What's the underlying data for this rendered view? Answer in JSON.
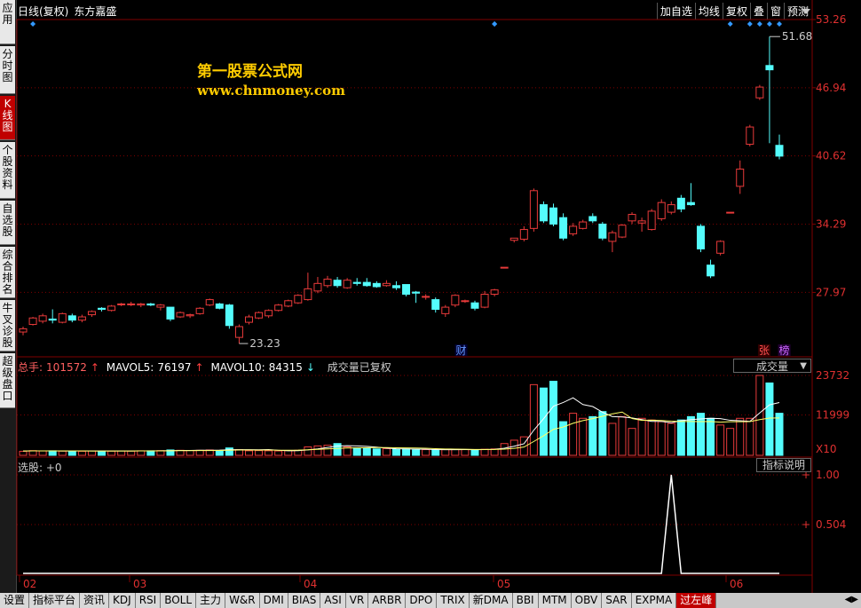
{
  "colors": {
    "up": "#e83a3a",
    "down": "#54fcfc",
    "grid": "#800000",
    "accent": "#ffcc00",
    "ma5": "#ffffff",
    "ma10": "#ffff66"
  },
  "sidebar": {
    "items": [
      {
        "label": "应用",
        "active": false
      },
      {
        "label": "分时图",
        "active": false
      },
      {
        "label": "K线图",
        "active": true
      },
      {
        "label": "个股资料",
        "active": false
      },
      {
        "label": "自选股",
        "active": false
      },
      {
        "label": "综合排名",
        "active": false
      },
      {
        "label": "牛叉诊股",
        "active": false
      },
      {
        "label": "超级盘口",
        "active": false
      }
    ]
  },
  "header": {
    "title": "日线(复权)",
    "stock_name": "东方嘉盛"
  },
  "toolbar": {
    "buttons": [
      "加自选",
      "均线",
      "复权",
      "叠",
      "窗",
      "预测"
    ],
    "dropdown_icon": "triangle-down-icon"
  },
  "watermark": {
    "line1": "第一股票公式网",
    "line2": "www.chnmoney.com"
  },
  "price_axis": {
    "ticks": [
      "53.26",
      "46.94",
      "40.62",
      "34.29",
      "27.97"
    ],
    "max_label": "51.68",
    "min_label": "23.23"
  },
  "markers": {
    "cai": "财",
    "zhang": "张",
    "bang": "榜"
  },
  "volume": {
    "total_label": "总手:",
    "total": "101572",
    "ma5_label": "MAVOL5:",
    "ma5": "76197",
    "ma10_label": "MAVOL10:",
    "ma10": "84315",
    "note": "成交量已复权",
    "selector": "成交量",
    "ticks": [
      "23732",
      "11999"
    ],
    "unit": "X10"
  },
  "selection": {
    "label": "选股: +0",
    "button": "指标说明",
    "ticks": [
      "1.00",
      "0.504"
    ]
  },
  "months": [
    "02",
    "03",
    "04",
    "05",
    "06"
  ],
  "bottom_tabs": [
    "设置",
    "指标平台",
    "资讯",
    "KDJ",
    "RSI",
    "BOLL",
    "主力",
    "W&R",
    "DMI",
    "BIAS",
    "ASI",
    "VR",
    "ARBR",
    "DPO",
    "TRIX",
    "新DMA",
    "BBI",
    "MTM",
    "OBV",
    "SAR",
    "EXPMA",
    "过左峰"
  ],
  "chart_data": {
    "type": "candlestick",
    "ylim": [
      22,
      53.26
    ],
    "candles": [
      [
        24.3,
        24.6,
        24.0,
        24.8
      ],
      [
        25.0,
        25.6,
        24.9,
        25.7
      ],
      [
        25.3,
        25.8,
        25.1,
        26.0
      ],
      [
        25.5,
        25.4,
        25.1,
        26.4
      ],
      [
        25.2,
        26.0,
        25.1,
        26.1
      ],
      [
        25.8,
        25.4,
        25.2,
        26.0
      ],
      [
        25.4,
        25.7,
        25.2,
        25.9
      ],
      [
        25.9,
        26.2,
        25.7,
        26.3
      ],
      [
        26.5,
        26.4,
        26.2,
        26.6
      ],
      [
        26.3,
        26.7,
        26.2,
        26.8
      ],
      [
        26.9,
        26.9,
        26.7,
        27.0
      ],
      [
        26.9,
        26.9,
        26.7,
        27.1
      ],
      [
        26.8,
        26.9,
        26.6,
        27.0
      ],
      [
        26.9,
        26.8,
        26.7,
        27.0
      ],
      [
        26.6,
        26.8,
        26.3,
        26.9
      ],
      [
        26.6,
        25.5,
        25.3,
        26.6
      ],
      [
        25.7,
        26.1,
        25.6,
        26.2
      ],
      [
        25.8,
        25.9,
        25.6,
        26.0
      ],
      [
        26.0,
        26.5,
        25.9,
        26.6
      ],
      [
        26.8,
        27.3,
        26.7,
        27.4
      ],
      [
        26.9,
        26.5,
        26.4,
        27.0
      ],
      [
        26.8,
        24.9,
        24.6,
        26.9
      ],
      [
        23.8,
        24.8,
        23.23,
        25.0
      ],
      [
        25.2,
        25.7,
        25.0,
        25.9
      ],
      [
        25.6,
        26.1,
        25.5,
        26.2
      ],
      [
        25.8,
        26.3,
        25.6,
        26.4
      ],
      [
        26.3,
        26.8,
        26.2,
        26.9
      ],
      [
        26.7,
        27.2,
        26.6,
        27.3
      ],
      [
        27.0,
        27.7,
        26.9,
        27.8
      ],
      [
        27.3,
        28.3,
        27.2,
        29.8
      ],
      [
        28.1,
        28.8,
        27.9,
        29.4
      ],
      [
        28.6,
        29.2,
        28.4,
        29.5
      ],
      [
        29.1,
        28.6,
        28.4,
        29.4
      ],
      [
        28.4,
        29.1,
        28.3,
        29.3
      ],
      [
        28.9,
        28.8,
        28.6,
        29.3
      ],
      [
        28.9,
        28.6,
        28.5,
        29.3
      ],
      [
        28.8,
        28.5,
        28.4,
        29.0
      ],
      [
        28.6,
        28.8,
        28.5,
        29.1
      ],
      [
        28.6,
        28.4,
        28.2,
        29.0
      ],
      [
        28.7,
        27.8,
        27.6,
        28.7
      ],
      [
        28.0,
        27.9,
        27.0,
        28.1
      ],
      [
        27.6,
        27.6,
        27.3,
        27.8
      ],
      [
        27.3,
        26.4,
        26.1,
        27.5
      ],
      [
        26.0,
        26.6,
        25.7,
        26.8
      ],
      [
        26.8,
        27.7,
        26.6,
        27.8
      ],
      [
        27.2,
        27.2,
        27.0,
        27.3
      ],
      [
        27.0,
        26.5,
        26.3,
        27.2
      ],
      [
        26.6,
        27.8,
        26.5,
        28.1
      ],
      [
        27.8,
        28.2,
        27.6,
        28.3
      ],
      [
        30.3,
        30.3,
        30.3,
        30.3
      ],
      [
        32.8,
        33.0,
        32.6,
        33.0
      ],
      [
        32.9,
        33.8,
        32.7,
        34.1
      ],
      [
        33.9,
        37.4,
        33.6,
        37.6
      ],
      [
        36.1,
        34.6,
        34.4,
        36.4
      ],
      [
        35.8,
        34.3,
        34.1,
        36.2
      ],
      [
        34.9,
        33.0,
        32.8,
        35.3
      ],
      [
        33.4,
        34.1,
        33.2,
        34.4
      ],
      [
        33.9,
        34.5,
        33.8,
        34.7
      ],
      [
        35.0,
        34.6,
        34.4,
        35.3
      ],
      [
        34.3,
        33.0,
        32.8,
        34.5
      ],
      [
        32.7,
        33.5,
        31.7,
        33.7
      ],
      [
        33.1,
        34.2,
        33.0,
        34.3
      ],
      [
        34.6,
        35.2,
        34.3,
        35.4
      ],
      [
        34.4,
        34.6,
        33.6,
        34.9
      ],
      [
        33.8,
        35.5,
        33.7,
        35.7
      ],
      [
        34.8,
        36.3,
        34.6,
        36.6
      ],
      [
        35.4,
        36.1,
        35.2,
        36.4
      ],
      [
        36.7,
        35.7,
        35.4,
        37.0
      ],
      [
        36.3,
        36.1,
        36.0,
        38.1
      ],
      [
        34.1,
        32.0,
        31.7,
        34.3
      ],
      [
        30.5,
        29.5,
        29.3,
        31.0
      ],
      [
        31.6,
        32.7,
        31.4,
        32.8
      ],
      [
        35.4,
        35.4,
        35.4,
        35.4
      ],
      [
        37.8,
        39.4,
        37.1,
        40.2
      ],
      [
        41.7,
        43.3,
        41.5,
        43.5
      ],
      [
        46.0,
        47.0,
        45.8,
        47.2
      ],
      [
        49.0,
        48.6,
        41.8,
        51.68
      ],
      [
        41.6,
        40.6,
        40.3,
        42.6
      ]
    ],
    "volumes": [
      1200,
      1400,
      1300,
      1350,
      1250,
      1300,
      1200,
      1300,
      1300,
      1250,
      1300,
      1250,
      1350,
      1350,
      1400,
      1600,
      1500,
      1450,
      1500,
      1600,
      1450,
      2200,
      1700,
      1350,
      1400,
      1350,
      1300,
      1400,
      1500,
      2500,
      2800,
      3000,
      3500,
      2500,
      2200,
      2100,
      1900,
      2000,
      1800,
      1900,
      1600,
      1700,
      1600,
      1700,
      1800,
      1700,
      1600,
      1800,
      1900,
      3500,
      4500,
      5500,
      21000,
      20000,
      22000,
      10000,
      12500,
      11000,
      11500,
      13000,
      9500,
      11500,
      8000,
      11000,
      10500,
      10000,
      9500,
      10500,
      11500,
      12500,
      11000,
      9000,
      8000,
      11000,
      11000,
      23732,
      21500,
      12500
    ],
    "ma5": [
      1300,
      1330,
      1310,
      1320,
      1300,
      1300,
      1310,
      1280,
      1280,
      1270,
      1300,
      1280,
      1310,
      1330,
      1350,
      1400,
      1440,
      1460,
      1500,
      1520,
      1540,
      1670,
      1690,
      1680,
      1660,
      1700,
      1500,
      1350,
      1390,
      1610,
      1900,
      2340,
      2760,
      2860,
      2800,
      2660,
      2440,
      2140,
      1960,
      1900,
      1840,
      1800,
      1720,
      1680,
      1680,
      1700,
      1680,
      1720,
      1780,
      2100,
      2700,
      3440,
      7480,
      10900,
      14600,
      15700,
      17100,
      15100,
      14500,
      12800,
      11500,
      11400,
      11100,
      10600,
      10100,
      10100,
      9700,
      10300,
      10600,
      10800,
      11000,
      10900,
      10400,
      10300,
      10100,
      12600,
      15000,
      15700
    ],
    "ma10": [
      1300,
      1310,
      1310,
      1320,
      1310,
      1310,
      1310,
      1300,
      1290,
      1290,
      1300,
      1300,
      1310,
      1310,
      1320,
      1350,
      1370,
      1390,
      1410,
      1430,
      1450,
      1520,
      1570,
      1570,
      1560,
      1570,
      1530,
      1520,
      1540,
      1650,
      1790,
      1920,
      2060,
      2160,
      2210,
      2270,
      2310,
      2300,
      2240,
      2210,
      2190,
      2110,
      1990,
      1890,
      1860,
      1800,
      1760,
      1740,
      1740,
      1860,
      2070,
      2470,
      4120,
      5810,
      7710,
      8420,
      9530,
      10320,
      10910,
      11590,
      12320,
      12850,
      10930,
      10390,
      10460,
      10350,
      10160,
      10060,
      10060,
      10010,
      10040,
      9860,
      10000,
      9980,
      10030,
      10600,
      11080,
      11100
    ],
    "signal_index": 66,
    "volume_ticks": [
      23732,
      11999
    ],
    "price_ticks": [
      53.26,
      46.94,
      40.62,
      34.29,
      27.97
    ]
  }
}
